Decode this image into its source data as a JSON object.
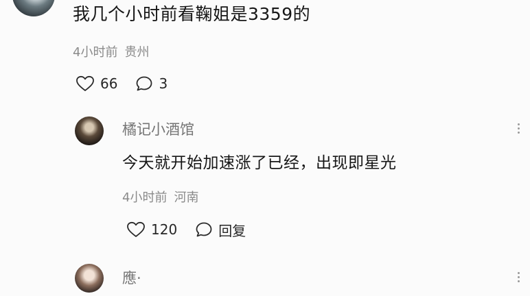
{
  "top_comment": {
    "text": "我几个小时前看鞠姐是3359的",
    "time": "4小时前",
    "location": "贵州",
    "likes": "66",
    "replies": "3"
  },
  "reply1": {
    "name": "橘记小酒馆",
    "text": "今天就开始加速涨了已经，出现即星光",
    "time": "4小时前",
    "location": "河南",
    "likes": "120",
    "reply_label": "回复"
  },
  "reply2": {
    "name": "應·"
  },
  "colors": {
    "background": "#fbfbfb",
    "meta_text": "#8a8a8a",
    "name_text": "#757575"
  }
}
